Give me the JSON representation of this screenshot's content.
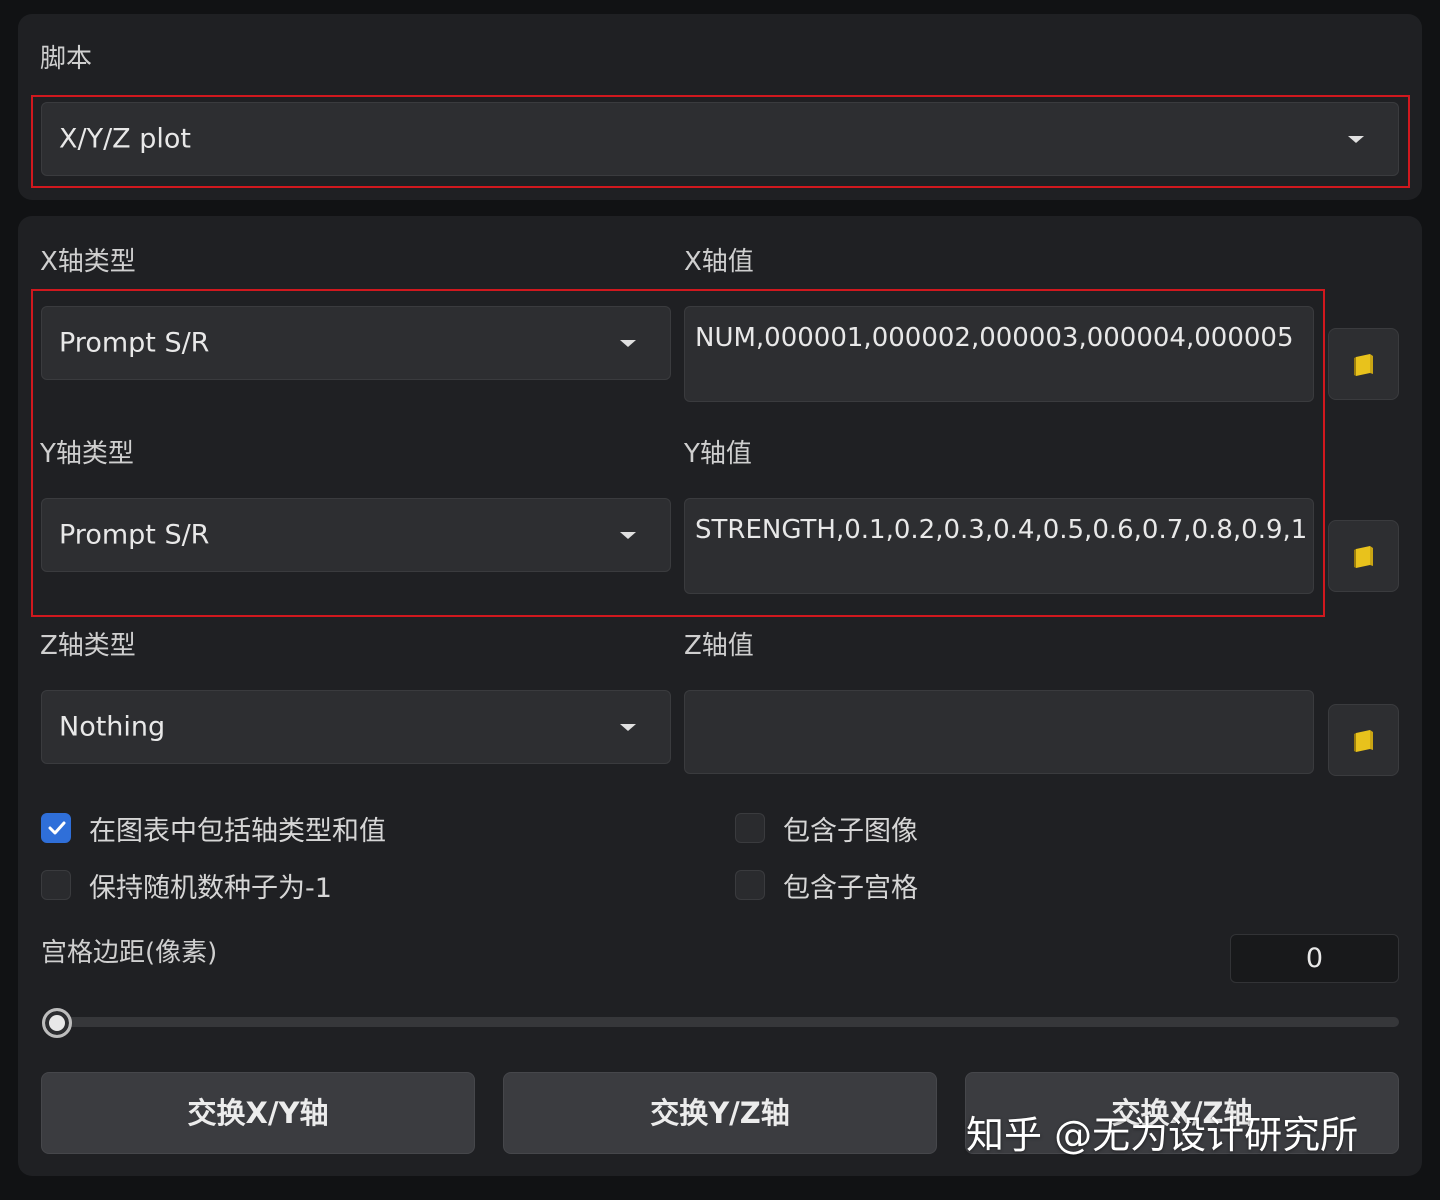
{
  "script_panel": {
    "label": "脚本",
    "selected": "X/Y/Z plot"
  },
  "x_axis": {
    "type_label": "X轴类型",
    "type_value": "Prompt S/R",
    "values_label": "X轴值",
    "values": "NUM,000001,000002,000003,000004,000005",
    "icon": "book-icon"
  },
  "y_axis": {
    "type_label": "Y轴类型",
    "type_value": "Prompt S/R",
    "values_label": "Y轴值",
    "values": "STRENGTH,0.1,0.2,0.3,0.4,0.5,0.6,0.7,0.8,0.9,1",
    "icon": "book-icon"
  },
  "z_axis": {
    "type_label": "Z轴类型",
    "type_value": "Nothing",
    "values_label": "Z轴值",
    "values": "",
    "icon": "book-icon"
  },
  "checkboxes": {
    "include_axis_labels": {
      "label": "在图表中包括轴类型和值",
      "checked": true
    },
    "keep_seed": {
      "label": "保持随机数种子为-1",
      "checked": false
    },
    "include_sub_images": {
      "label": "包含子图像",
      "checked": false
    },
    "include_sub_grids": {
      "label": "包含子宫格",
      "checked": false
    }
  },
  "grid_margin": {
    "label": "宫格边距(像素)",
    "value": "0",
    "slider_fraction": 0
  },
  "buttons": {
    "swap_xy": "交换X/Y轴",
    "swap_yz": "交换Y/Z轴",
    "swap_xz": "交换X/Z轴"
  },
  "watermark": "知乎 @无为设计研究所",
  "colors": {
    "highlight": "#d0181e",
    "checkbox_checked": "#2f6fd9",
    "icon_yellow": "#e8c21c"
  }
}
